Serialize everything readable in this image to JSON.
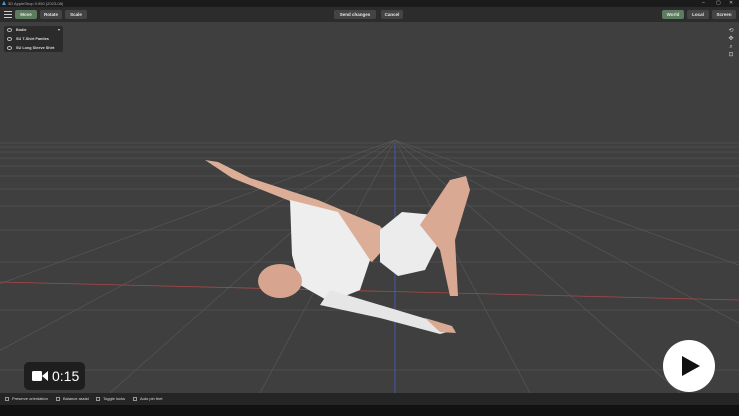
{
  "app": {
    "title": "3D AppleShop 0.950 (2023-08)"
  },
  "window_controls": [
    "–",
    "▢",
    "✕"
  ],
  "toolbar": {
    "transform_modes": [
      {
        "label": "Move",
        "active": true
      },
      {
        "label": "Rotate",
        "active": false
      },
      {
        "label": "Scale",
        "active": false
      }
    ],
    "send_label": "Send changes",
    "cancel_label": "Cancel",
    "spaces": [
      {
        "label": "World",
        "active": true
      },
      {
        "label": "Local",
        "active": false
      },
      {
        "label": "Screen",
        "active": false
      }
    ]
  },
  "scene_panel": {
    "items": [
      {
        "label": "Bodie",
        "expand": "▾"
      },
      {
        "label": "SU T-Shirt Panties"
      },
      {
        "label": "SU Long Sleeve Shirt"
      }
    ]
  },
  "right_tools": [
    "rotate-view-icon",
    "pan-icon",
    "zoom-icon",
    "frame-icon"
  ],
  "statusbar": {
    "items": [
      {
        "label": "Preserve orientation"
      },
      {
        "label": "Balance assist"
      },
      {
        "label": "Toggle locks"
      },
      {
        "label": "Auto pin feet"
      }
    ]
  },
  "video": {
    "duration": "0:15"
  },
  "colors": {
    "accent_active": "#5d7b5f",
    "x_axis": "#b04040",
    "y_axis": "#4050c0"
  }
}
